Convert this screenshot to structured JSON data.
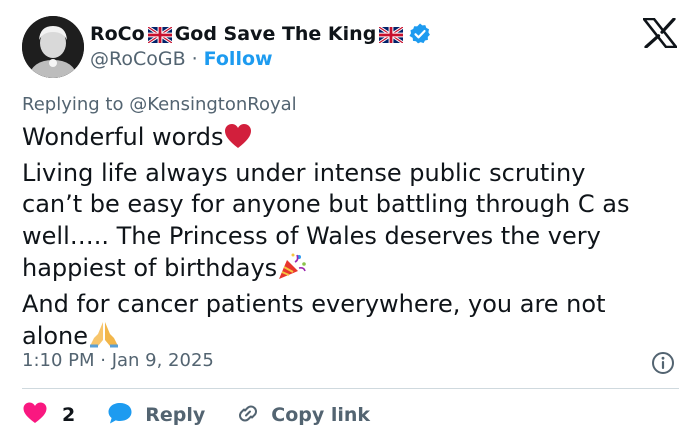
{
  "header": {
    "display_name_part1": "RoCo",
    "display_name_part2": "God Save The King",
    "handle": "@RoCoGB",
    "separator": "·",
    "follow_label": "Follow"
  },
  "replying_to": "Replying to @KensingtonRoyal",
  "tweet_lines": [
    "Wonderful words",
    "Living life always under intense public scrutiny",
    "can’t be easy for anyone but battling through C as",
    "well….. The Princess of Wales deserves the very",
    "happiest of birthdays",
    "And for cancer patients everywhere, you are not",
    "alone"
  ],
  "timestamp": "1:10 PM · Jan 9, 2025",
  "actions": {
    "like_count": "2",
    "reply_label": "Reply",
    "copy_link_label": "Copy link"
  },
  "icons": [
    "uk-flag-icon",
    "verified-badge-icon",
    "x-logo-icon",
    "heart-icon",
    "party-popper-icon",
    "praying-hands-icon",
    "info-icon",
    "reply-bubble-icon",
    "link-icon"
  ],
  "colors": {
    "follow": "#1d9bf0",
    "verified": "#1d9bf0",
    "like": "#f91880",
    "secondary_text": "#536471",
    "primary_text": "#0f1419"
  }
}
